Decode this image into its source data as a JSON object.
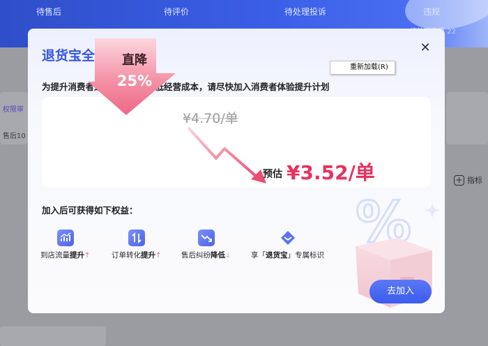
{
  "background": {
    "tabs": [
      "待售后",
      "待评价",
      "待处理投诉",
      "违规"
    ],
    "header_note": "待处理事项 22",
    "permission_text": "权限审",
    "sales_text": "售后10",
    "metric_label": "指标",
    "metric_icon": "plus-square-icon"
  },
  "modal": {
    "title": "退货宝全新上线",
    "close_icon": "close-icon",
    "reload_tooltip": "重新加载(R)",
    "subtitle": "为提升消费者退换货体验，降低经营成本，请尽快加入消费者体验提升计划",
    "price": {
      "arrow_title": "直降",
      "drop_percent": "25%",
      "old_price": "¥4.70/单",
      "est_label": "预估",
      "new_price": "¥3.52/单"
    },
    "benefits_title": "加入后可获得如下权益：",
    "benefits": [
      {
        "icon": "traffic-chart-icon",
        "prefix": "到店流量",
        "bold": "提升",
        "arrow": "↑"
      },
      {
        "icon": "conversion-arrows-icon",
        "prefix": "订单转化",
        "bold": "提升",
        "arrow": "↑"
      },
      {
        "icon": "dispute-down-icon",
        "prefix": "售后纠纷",
        "bold": "降低",
        "arrow": "↓"
      },
      {
        "icon": "badge-heart-icon",
        "prefix": "享「",
        "bold": "退货宝",
        "suffix": "」专属标识"
      }
    ],
    "join_button": "去加入"
  },
  "colors": {
    "accent": "#3456e0",
    "price_red": "#e8325f",
    "button": "#3b5ced"
  }
}
